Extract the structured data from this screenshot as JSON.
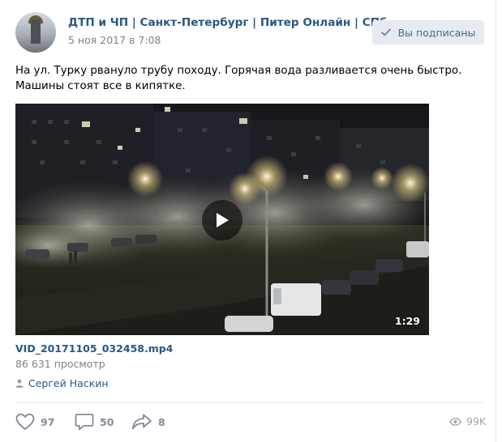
{
  "header": {
    "group_name": "ДТП и ЧП | Санкт-Петербург | Питер Онлайн | СПб",
    "date": "5 ноя 2017 в 7:08",
    "subscribed_label": "Вы подписаны",
    "avatar_label": "ДТП и ЧП\nСанкт-Петербург"
  },
  "post": {
    "text": "На ул. Турку рвануло трубу походу. Горячая вода разливается очень быстро. Машины стоят все в кипятке."
  },
  "video": {
    "duration": "1:29",
    "title": "VID_20171105_032458.mp4",
    "views": "86 631 просмотр"
  },
  "author": {
    "name": "Сергей Наскин"
  },
  "footer": {
    "likes": "97",
    "comments": "50",
    "shares": "8",
    "views": "99K"
  },
  "colors": {
    "link": "#2a5885",
    "muted": "#828282",
    "button_bg": "#e5ebf1",
    "action_icon": "#828a99"
  },
  "icons": {
    "subscribed": "check-icon",
    "play": "play-icon",
    "author": "user-icon",
    "like": "heart-icon",
    "comment": "comment-icon",
    "share": "share-icon",
    "views": "eye-icon"
  }
}
